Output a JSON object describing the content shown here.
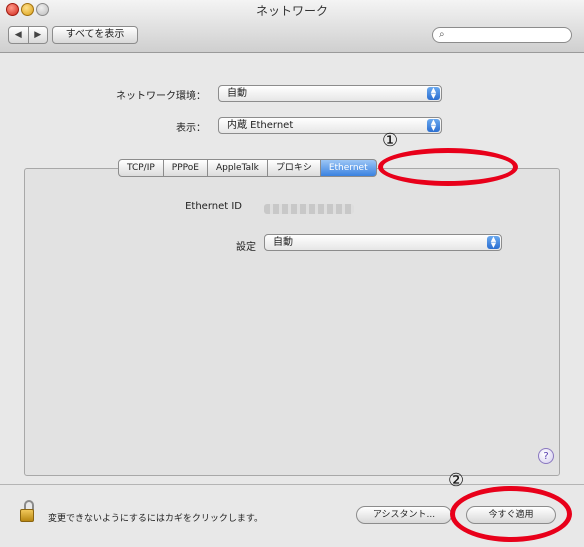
{
  "window": {
    "title": "ネットワーク"
  },
  "toolbar": {
    "back_label": "◀",
    "forward_label": "▶",
    "show_all_label": "すべてを表示",
    "search_icon": "⌕",
    "search_placeholder": ""
  },
  "form": {
    "location_label": "ネットワーク環境：",
    "location_value": "自動",
    "show_label": "表示：",
    "show_value": "内蔵 Ethernet"
  },
  "tabs": [
    {
      "label": "TCP/IP",
      "active": false
    },
    {
      "label": "PPPoE",
      "active": false
    },
    {
      "label": "AppleTalk",
      "active": false
    },
    {
      "label": "プロキシ",
      "active": false
    },
    {
      "label": "Ethernet",
      "active": true
    }
  ],
  "ethernet": {
    "id_label": "Ethernet ID",
    "config_label": "設定",
    "config_value": "自動"
  },
  "help_label": "?",
  "footer": {
    "lock_text": "変更できないようにするにはカギをクリックします。",
    "assist_label": "アシスタント...",
    "apply_label": "今すぐ適用"
  },
  "annotations": {
    "one": "①",
    "two": "②"
  },
  "colors": {
    "annotation": "#e8001a",
    "accent": "#3a82e0"
  },
  "icons": {
    "popup_arrows": "▲▼"
  }
}
